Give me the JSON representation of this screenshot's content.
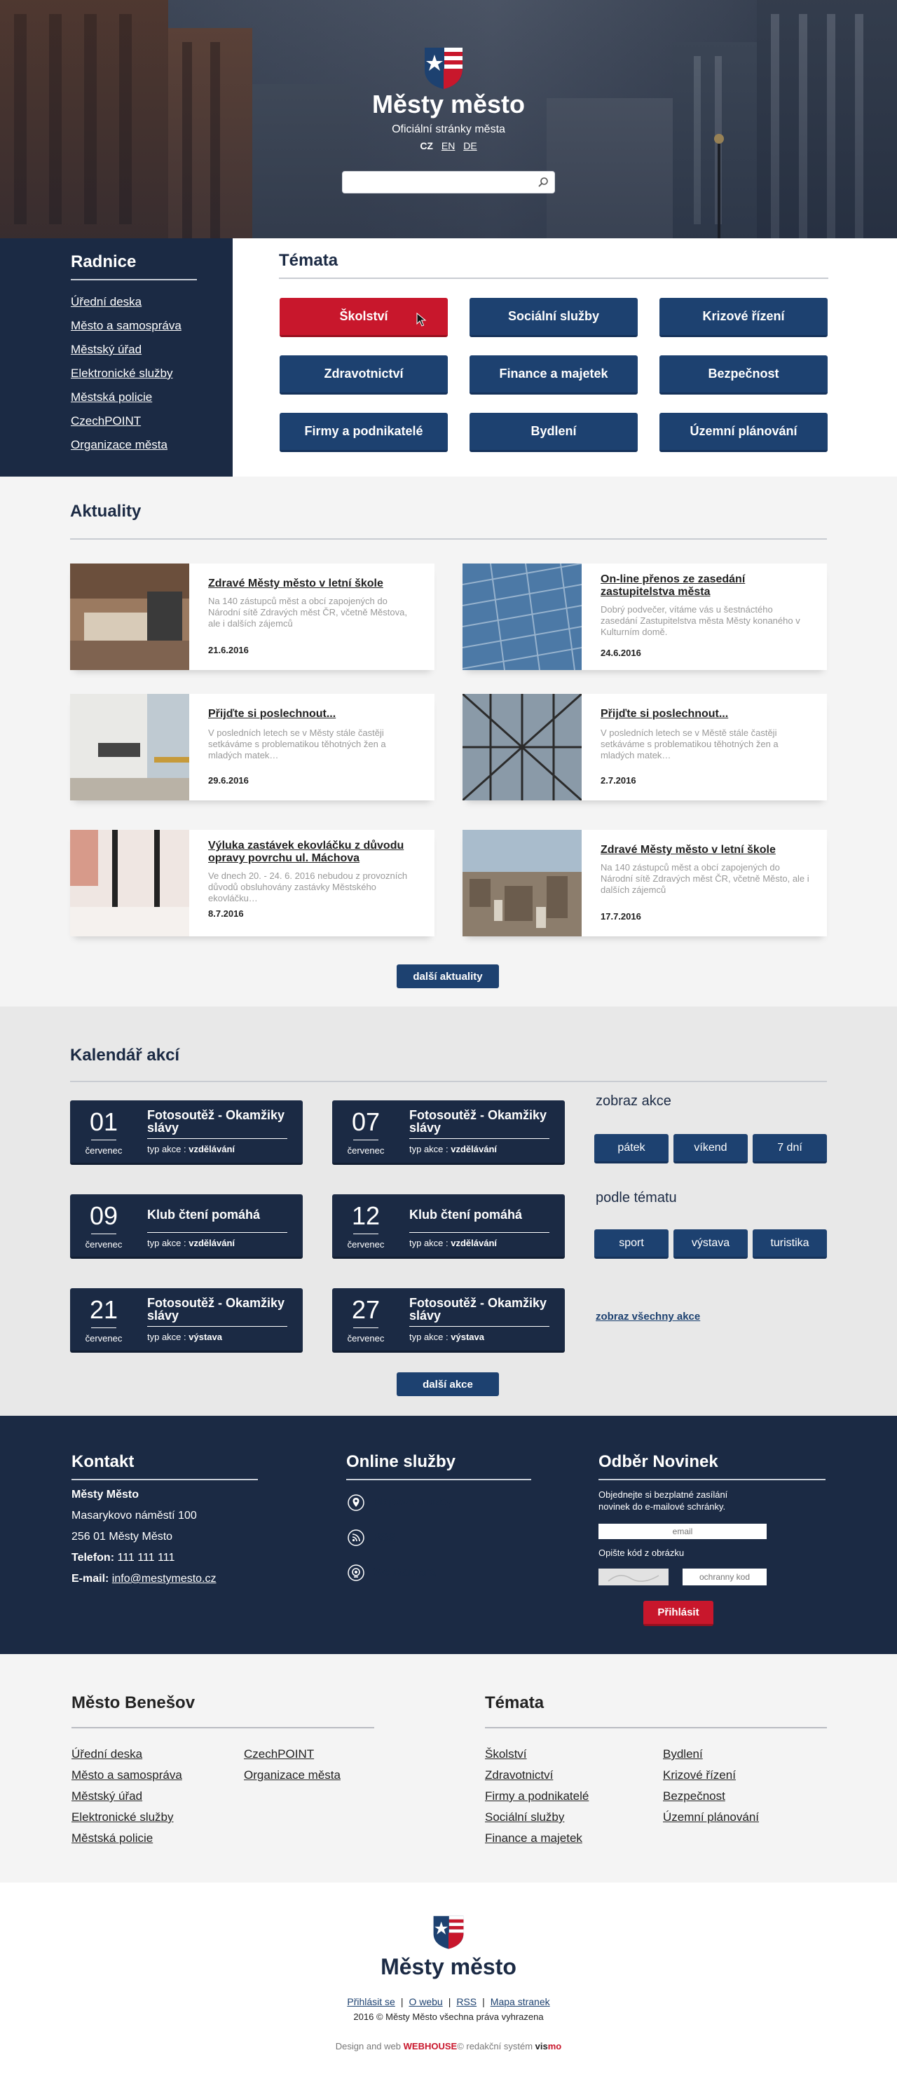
{
  "hero": {
    "title": "Městy město",
    "subtitle": "Oficiální stránky města",
    "languages": [
      "CZ",
      "EN",
      "DE"
    ],
    "search_placeholder": ""
  },
  "radnice": {
    "title": "Radnice",
    "items": [
      "Úřední deska",
      "Město a samospráva",
      "Městský úřad",
      "Elektronické služby",
      "Městská policie",
      "CzechPOINT",
      "Organizace města"
    ]
  },
  "temata": {
    "title": "Témata",
    "buttons": [
      "Školství",
      "Sociální služby",
      "Krizové řízení",
      "Zdravotnictví",
      "Finance a majetek",
      "Bezpečnost",
      "Firmy a podnikatelé",
      "Bydlení",
      "Územní plánování"
    ]
  },
  "aktuality": {
    "title": "Aktuality",
    "items": [
      {
        "title": "Zdravé Městy město v letní škole",
        "text": "Na 140 zástupců měst a obcí zapojených do Národní sítě Zdravých měst ČR, včetně Městova, ale i dalších zájemců",
        "date": "21.6.2016"
      },
      {
        "title": "On-line přenos ze zasedání zastupitelstva města",
        "text": "Dobrý podvečer, vítáme vás u šestnáctého zasedání Zastupitelstva města Městy konaného v Kulturním domě.",
        "date": "24.6.2016"
      },
      {
        "title": "Přijďte si poslechnout...",
        "text": "V posledních letech se v Městy stále častěji setkáváme s problematikou těhotných žen a mladých matek…",
        "date": "29.6.2016"
      },
      {
        "title": "Přijďte si poslechnout...",
        "text": "V posledních letech se v Městě stále častěji setkáváme s problematikou těhotných žen a mladých matek…",
        "date": "2.7.2016"
      },
      {
        "title": "Výluka zastávek ekovláčku z důvodu opravy povrchu ul. Máchova",
        "text": "Ve dnech 20. - 24. 6. 2016 nebudou z provozních důvodů obsluhovány zastávky Městského ekovláčku…",
        "date": "8.7.2016"
      },
      {
        "title": "Zdravé Městy město v letní škole",
        "text": "Na 140 zástupců měst a obcí zapojených do Národní sítě Zdravých měst ČR, včetně Město, ale i dalších zájemců",
        "date": "17.7.2016"
      }
    ],
    "more": "další aktuality"
  },
  "kalendar": {
    "title": "Kalendář akcí",
    "type_label": "typ akce :",
    "events": [
      {
        "day": "01",
        "month": "červenec",
        "title": "Fotosoutěž - Okamžiky slávy",
        "type": "vzdělávání"
      },
      {
        "day": "07",
        "month": "červenec",
        "title": "Fotosoutěž - Okamžiky slávy",
        "type": "vzdělávání"
      },
      {
        "day": "09",
        "month": "červenec",
        "title": "Klub čtení pomáhá",
        "type": "vzdělávání"
      },
      {
        "day": "12",
        "month": "červenec",
        "title": "Klub čtení pomáhá",
        "type": "vzdělávání"
      },
      {
        "day": "21",
        "month": "červenec",
        "title": "Fotosoutěž - Okamžiky slávy",
        "type": "výstava"
      },
      {
        "day": "27",
        "month": "červenec",
        "title": "Fotosoutěž - Okamžiky slávy",
        "type": "výstava"
      }
    ],
    "show_title": "zobraz akce",
    "show_buttons": [
      "pátek",
      "víkend",
      "7 dní"
    ],
    "topic_title": "podle tématu",
    "topic_buttons": [
      "sport",
      "výstava",
      "turistika"
    ],
    "all_link": "zobraz všechny akce",
    "more": "další akce"
  },
  "kontakt": {
    "title": "Kontakt",
    "name": "Městy Město",
    "address1": "Masarykovo náměstí 100",
    "address2": "256 01 Městy Město",
    "phone_label": "Telefon:",
    "phone": "111 111 111",
    "email_label": "E-mail:",
    "email": "info@mestymesto.cz"
  },
  "online": {
    "title": "Online služby",
    "items": [
      "Mapove sluzby",
      "RSS",
      "Webkamera"
    ]
  },
  "novinky": {
    "title": "Odběr Novinek",
    "text": "Objednejte si bezplatné zasílání novinek do e-mailové schránky.",
    "email_placeholder": "email",
    "captcha_label": "Opište kód z obrázku",
    "captcha_placeholder": "ochranny kod",
    "submit": "Přihlásit"
  },
  "footer_links": {
    "city_title": "Město Benešov",
    "city_col1": [
      "Úřední deska",
      "Město a samospráva",
      "Městský úřad",
      "Elektronické služby",
      "Městská policie"
    ],
    "city_col2": [
      "CzechPOINT",
      "Organizace města"
    ],
    "temata_title": "Témata",
    "temata_col1": [
      "Školství",
      "Zdravotnictví",
      "Firmy a podnikatelé",
      "Sociální služby",
      "Finance a majetek"
    ],
    "temata_col2": [
      "Bydlení",
      "Krizové řízení",
      "Bezpečnost",
      "Územní plánování"
    ]
  },
  "bottom": {
    "title": "Městy město",
    "links": [
      "Přihlásit se",
      "O webu",
      "RSS",
      "Mapa stranek"
    ],
    "copyright": "2016 © Městy Město všechna práva vyhrazena",
    "credit_prefix": "Design and web",
    "credit_webhouse": "WEBHOUSE",
    "credit_mid": "© redakční systém",
    "credit_vis": "vis",
    "credit_mo": "mo"
  },
  "colors": {
    "navy": "#1b2a44",
    "blue": "#1d4170",
    "red": "#c8172c",
    "light": "#f4f4f4",
    "grey": "#e8e8e8"
  }
}
